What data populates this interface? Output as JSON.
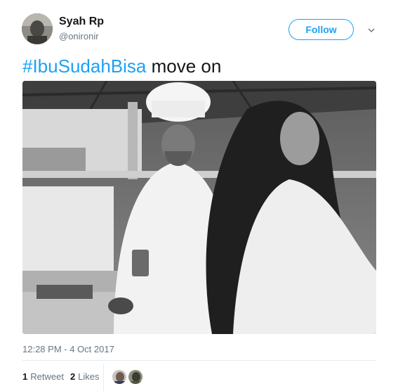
{
  "author": {
    "display_name": "Syah Rp",
    "handle": "@onironir"
  },
  "follow_label": "Follow",
  "tweet": {
    "hashtag": "#IbuSudahBisa",
    "text": " move on"
  },
  "timestamp": "12:28 PM - 4 Oct 2017",
  "stats": {
    "retweets_count": "1",
    "retweets_label": "Retweet",
    "likes_count": "2",
    "likes_label": "Likes"
  },
  "colors": {
    "accent": "#1da1f2",
    "secondary_text": "#657786",
    "primary_text": "#14171a"
  },
  "icons": {
    "menu": "chevron-down-icon"
  }
}
